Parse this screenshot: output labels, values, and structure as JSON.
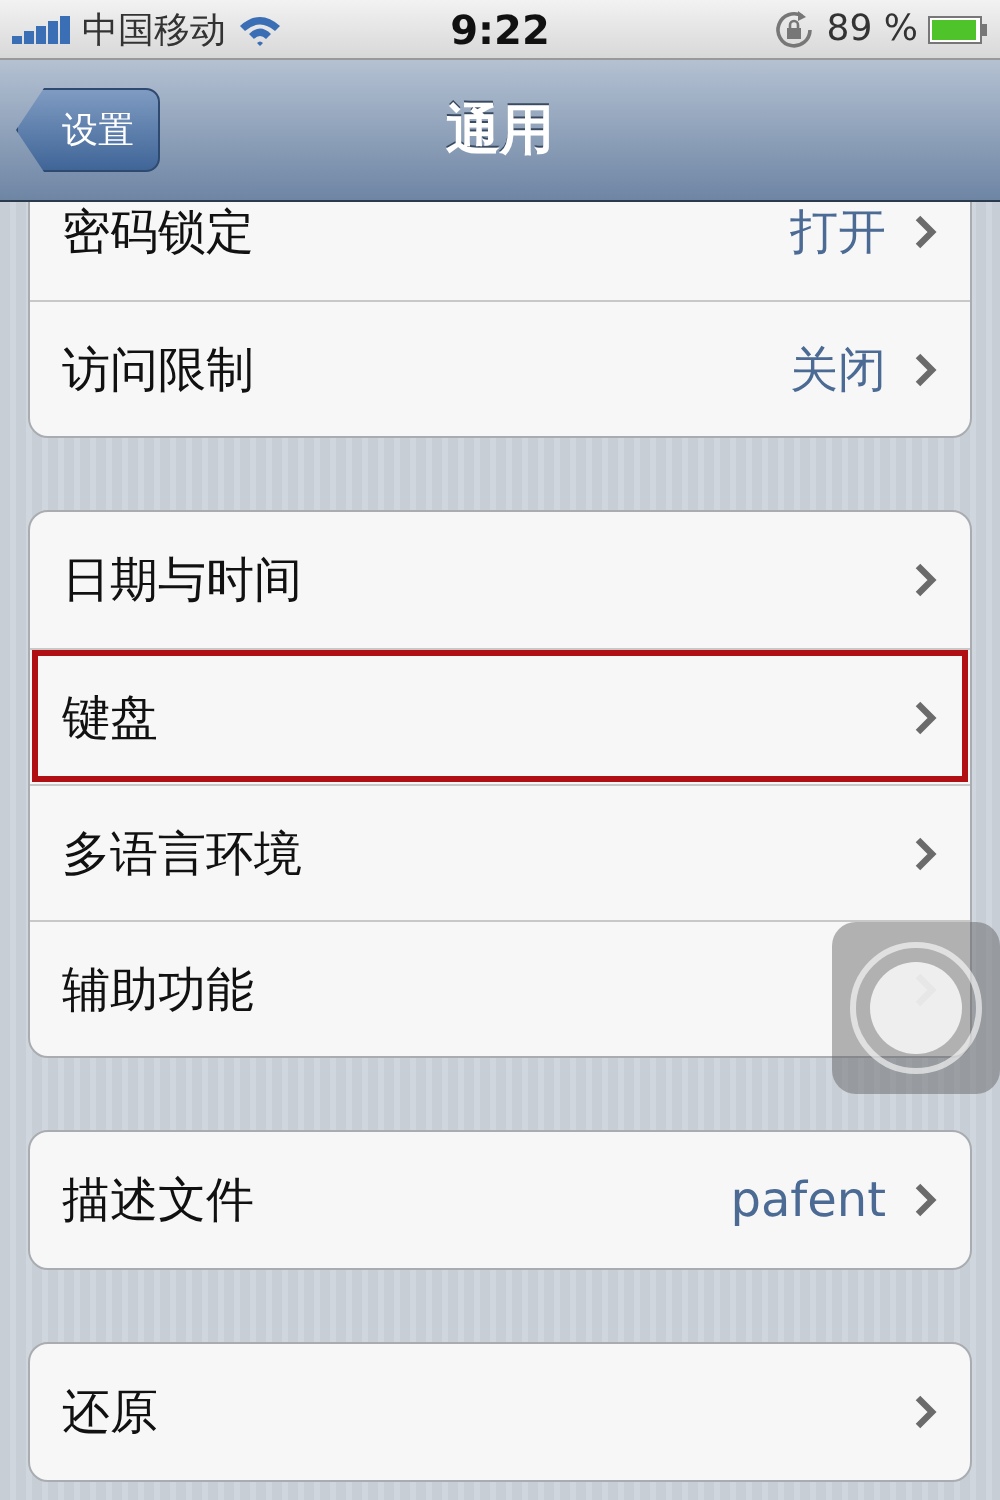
{
  "status_bar": {
    "carrier": "中国移动",
    "time": "9:22",
    "battery": "89 %"
  },
  "nav_bar": {
    "back": "设置",
    "title": "通用"
  },
  "groups": [
    {
      "rows": [
        {
          "label": "密码锁定",
          "value": "打开",
          "highlighted": false
        },
        {
          "label": "访问限制",
          "value": "关闭",
          "highlighted": false
        }
      ]
    },
    {
      "rows": [
        {
          "label": "日期与时间",
          "highlighted": false
        },
        {
          "label": "键盘",
          "highlighted": true
        },
        {
          "label": "多语言环境",
          "highlighted": false
        },
        {
          "label": "辅助功能",
          "highlighted": false
        }
      ]
    },
    {
      "rows": [
        {
          "label": "描述文件",
          "value": "pafent",
          "highlighted": false
        }
      ]
    },
    {
      "rows": [
        {
          "label": "还原",
          "highlighted": false
        }
      ]
    }
  ]
}
